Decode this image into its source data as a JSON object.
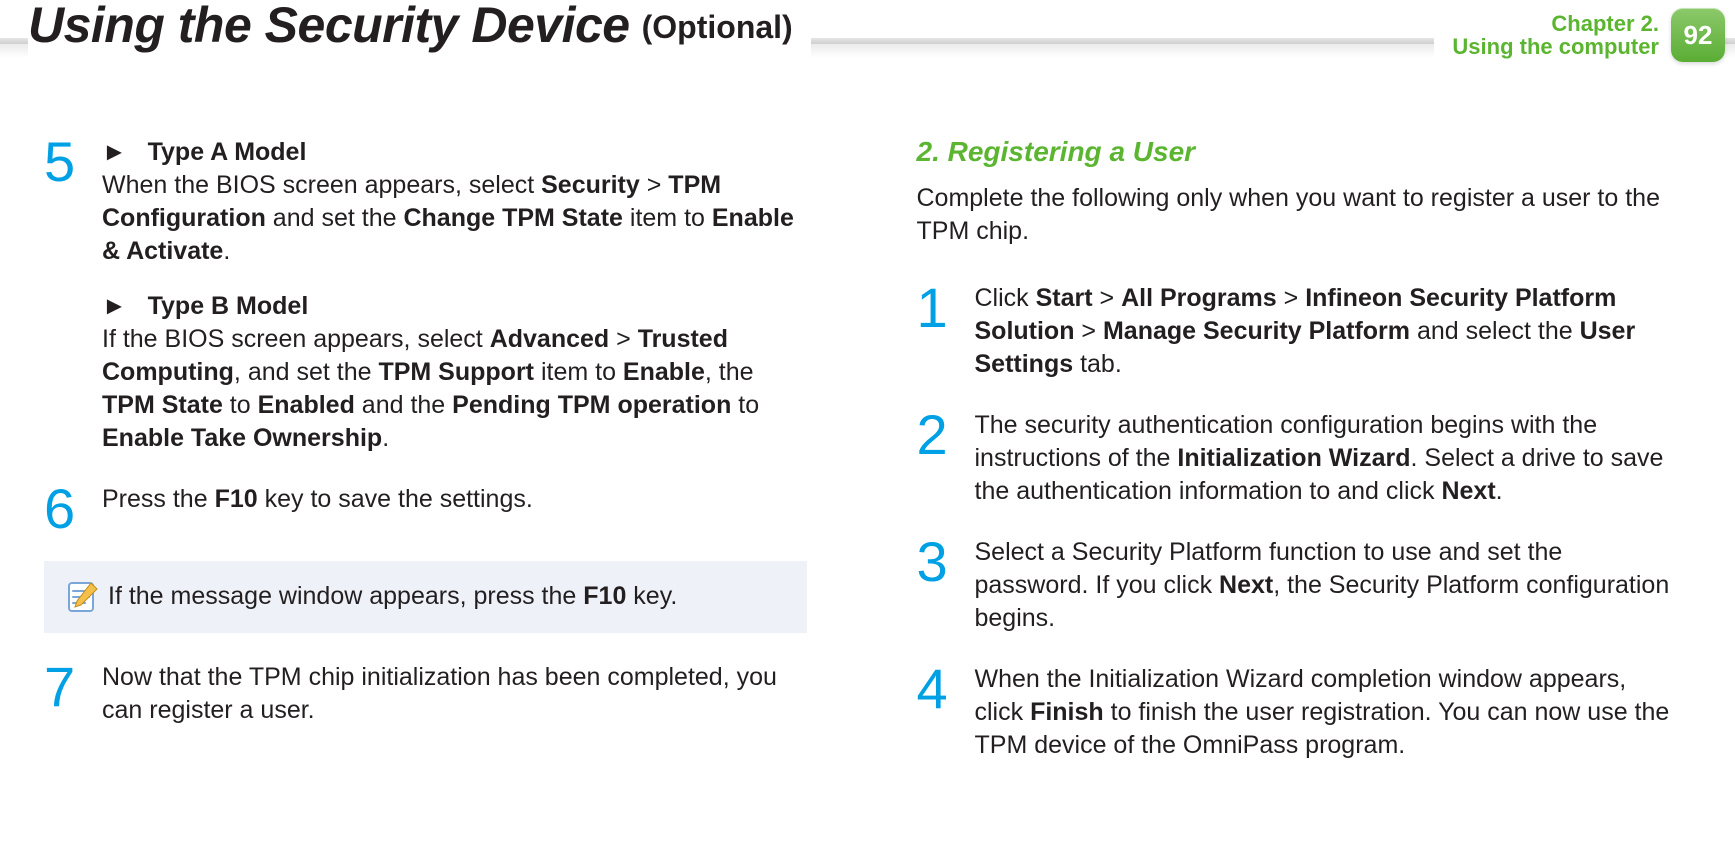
{
  "header": {
    "title": "Using the Security Device",
    "subtitle": "(Optional)",
    "chapter_line1": "Chapter 2.",
    "chapter_line2": "Using the computer",
    "page_number": "92"
  },
  "left": {
    "step5": {
      "num": "5",
      "a_marker": "►",
      "a_title": "Type A Model",
      "a_t1": "When the BIOS screen appears, select ",
      "a_b1": "Security",
      "a_gt1": " > ",
      "a_b2": "TPM Configuration",
      "a_t2": " and set the ",
      "a_b3": "Change TPM State",
      "a_t3": " item to ",
      "a_b4": "Enable & Activate",
      "a_t4": ".",
      "b_marker": "►",
      "b_title": "Type B Model",
      "b_t1": "If the BIOS screen appears, select ",
      "b_b1": "Advanced",
      "b_gt1": " > ",
      "b_b2": "Trusted Computing",
      "b_t2": ", and set the ",
      "b_b3": "TPM Support",
      "b_t3": " item to ",
      "b_b4": "Enable",
      "b_t4": ", the ",
      "b_b5": "TPM State",
      "b_t5": " to ",
      "b_b6": "Enabled",
      "b_t6": " and the ",
      "b_b7": "Pending TPM operation",
      "b_t7": " to ",
      "b_b8": "Enable Take Ownership",
      "b_t8": "."
    },
    "step6": {
      "num": "6",
      "t1": "Press the ",
      "b1": "F10",
      "t2": " key to save the settings."
    },
    "note": {
      "t1": "If the message window appears, press the ",
      "b1": "F10",
      "t2": " key."
    },
    "step7": {
      "num": "7",
      "t1": "Now that the TPM chip initialization has been completed, you can register a user."
    }
  },
  "right": {
    "heading": "2. Registering a User",
    "intro": "Complete the following only when you want to register a user to the TPM chip.",
    "step1": {
      "num": "1",
      "t1": "Click ",
      "b1": "Start",
      "gt1": " > ",
      "b2": "All Programs",
      "gt2": " > ",
      "b3": "Infineon Security Platform Solution",
      "gt3": " > ",
      "b4": "Manage Security Platform",
      "t2": " and select the ",
      "b5": "User Settings",
      "t3": " tab."
    },
    "step2": {
      "num": "2",
      "t1": "The security authentication configuration begins with the instructions of the ",
      "b1": "Initialization Wizard",
      "t2": ". Select a drive to save the authentication information to and click ",
      "b2": "Next",
      "t3": "."
    },
    "step3": {
      "num": "3",
      "t1": "Select a Security Platform function to use and set the password. If you click ",
      "b1": "Next",
      "t2": ", the Security Platform configuration begins."
    },
    "step4": {
      "num": "4",
      "t1": "When the Initialization Wizard completion window appears, click ",
      "b1": "Finish",
      "t2": " to finish the user registration. You can now use the TPM device of the OmniPass program."
    }
  }
}
